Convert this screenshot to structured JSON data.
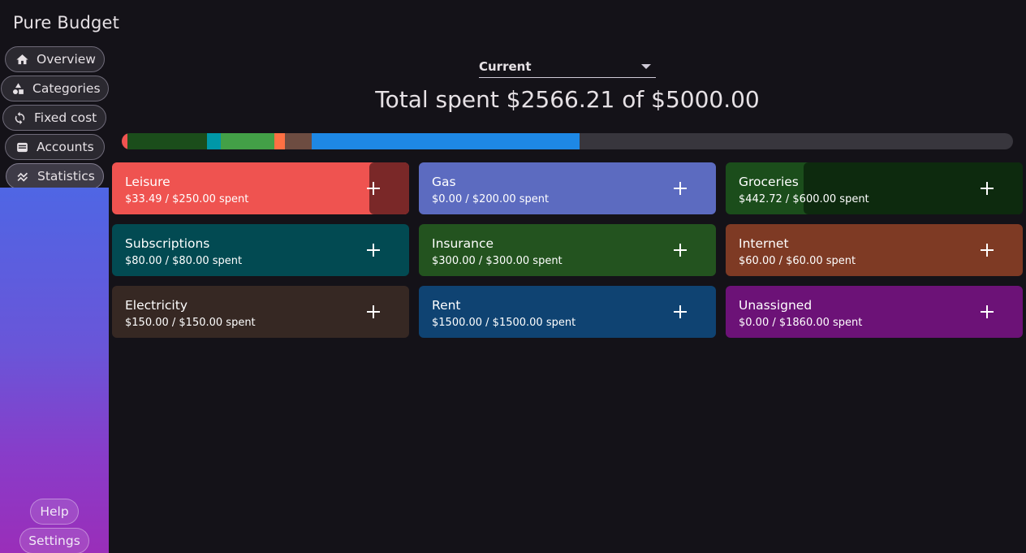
{
  "app": {
    "title": "Pure Budget"
  },
  "nav": {
    "overview": "Overview",
    "categories": "Categories",
    "fixed_cost": "Fixed cost",
    "accounts": "Accounts",
    "statistics": "Statistics"
  },
  "footer": {
    "help": "Help",
    "settings": "Settings"
  },
  "period": {
    "selected": "Current"
  },
  "summary": {
    "total_text": "Total spent $2566.21 of $5000.00",
    "spent": 2566.21,
    "budget": 5000.0
  },
  "spend_bar": {
    "segments": [
      {
        "name": "Leisure",
        "amount": 33.49,
        "color": "#ef5350"
      },
      {
        "name": "Groceries",
        "amount": 442.72,
        "color": "#1b4d1b"
      },
      {
        "name": "Subscriptions",
        "amount": 80.0,
        "color": "#0097a7"
      },
      {
        "name": "Insurance",
        "amount": 300.0,
        "color": "#43a047"
      },
      {
        "name": "Internet",
        "amount": 60.0,
        "color": "#ff7043"
      },
      {
        "name": "Electricity",
        "amount": 150.0,
        "color": "#6d4c41"
      },
      {
        "name": "Rent",
        "amount": 1500.0,
        "color": "#1e88e5"
      }
    ],
    "track_color": "#38363d"
  },
  "categories": [
    {
      "name": "Leisure",
      "spent_text": "$33.49 / $250.00 spent",
      "color": "#ef5350",
      "overlay": "#7a2828",
      "overlay_fraction": 0.134
    },
    {
      "name": "Gas",
      "spent_text": "$0.00 / $200.00 spent",
      "color": "#5c6bc0",
      "overlay": "",
      "overlay_fraction": 0
    },
    {
      "name": "Groceries",
      "spent_text": "$442.72 / $600.00 spent",
      "color": "#1b4d1b",
      "overlay": "#0d2a0e",
      "overlay_fraction": 0.738
    },
    {
      "name": "Subscriptions",
      "spent_text": "$80.00 / $80.00 spent",
      "color": "#024a52",
      "overlay": "",
      "overlay_fraction": 0
    },
    {
      "name": "Insurance",
      "spent_text": "$300.00 / $300.00 spent",
      "color": "#23531f",
      "overlay": "",
      "overlay_fraction": 0
    },
    {
      "name": "Internet",
      "spent_text": "$60.00 / $60.00 spent",
      "color": "#7e3a24",
      "overlay": "",
      "overlay_fraction": 0
    },
    {
      "name": "Electricity",
      "spent_text": "$150.00 / $150.00 spent",
      "color": "#362823",
      "overlay": "",
      "overlay_fraction": 0
    },
    {
      "name": "Rent",
      "spent_text": "$1500.00 / $1500.00 spent",
      "color": "#0f4372",
      "overlay": "",
      "overlay_fraction": 0
    },
    {
      "name": "Unassigned",
      "spent_text": "$0.00 / $1860.00 spent",
      "color": "#6c1277",
      "overlay": "",
      "overlay_fraction": 0
    }
  ],
  "icons": {
    "overview": "home-icon",
    "categories": "shapes-icon",
    "fixed_cost": "refresh-icon",
    "accounts": "wallet-icon",
    "statistics": "chart-icon",
    "add": "plus-icon",
    "dropdown": "chevron-down-icon"
  }
}
